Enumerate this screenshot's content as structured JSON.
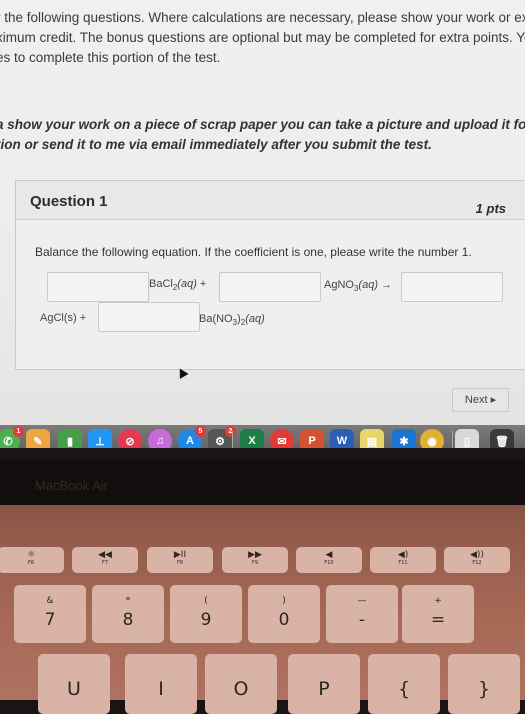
{
  "instructions": {
    "line1": "r the following questions.  Where calculations are necessary, please show your work or explain",
    "line2": "ximum credit.  The bonus questions are optional but may be completed for extra points.  You ha",
    "line3": "es to complete this portion of the test.",
    "line4": "a show your work on a piece of scrap paper you can take a picture and upload it for the last",
    "line5": "tion or send it to me via email immediately after you submit the test."
  },
  "question": {
    "title": "Question 1",
    "points": "1 pts",
    "prompt": "Balance the following equation.  If the coefficient is one, please write the number 1.",
    "terms": {
      "bacl2": "BaCl",
      "bacl2_sub": "2",
      "bacl2_state": "(aq)",
      "plus1": "+",
      "agno3": "AgNO",
      "agno3_sub": "3",
      "agno3_state": "(aq)",
      "arrow": "→",
      "agcl": "AgCl(s)",
      "plus2": "+",
      "bano3": "Ba(NO",
      "bano3_sub1": "3",
      "bano3_mid": ")",
      "bano3_sub2": "2",
      "bano3_state": "(aq)"
    },
    "blanks": [
      "",
      "",
      "",
      ""
    ]
  },
  "navigation": {
    "next_label": "Next ▸"
  },
  "dock": {
    "apps": [
      {
        "name": "FaceTime",
        "glyph": "✆",
        "color": "#4caf50",
        "badge": "1"
      },
      {
        "name": "Pages",
        "glyph": "✎",
        "color": "#f0a640"
      },
      {
        "name": "Numbers",
        "glyph": "▮",
        "color": "#43a047"
      },
      {
        "name": "Keynote",
        "glyph": "⊥",
        "color": "#2196f3"
      },
      {
        "name": "News",
        "glyph": "⊘",
        "color": "#e53950"
      },
      {
        "name": "iTunes",
        "glyph": "♫",
        "color": "#c66bd8"
      },
      {
        "name": "App Store",
        "glyph": "A",
        "color": "#1e88e5",
        "badge": "5"
      },
      {
        "name": "System Preferences",
        "glyph": "⚙",
        "color": "#555555",
        "badge": "2"
      },
      {
        "name": "Excel",
        "glyph": "X",
        "color": "#1e7e45"
      },
      {
        "name": "Mail",
        "glyph": "✉",
        "color": "#e53935"
      },
      {
        "name": "PowerPoint",
        "glyph": "P",
        "color": "#d35230"
      },
      {
        "name": "Word",
        "glyph": "W",
        "color": "#2b5fb5"
      },
      {
        "name": "Stickies",
        "glyph": "▤",
        "color": "#e8d66a"
      },
      {
        "name": "Bluetooth File Exchange",
        "glyph": "✱",
        "color": "#1976d2"
      },
      {
        "name": "Chrome",
        "glyph": "◉",
        "color": "#e0b030"
      },
      {
        "name": "Documents",
        "glyph": "▯",
        "color": "#d8d8d8"
      },
      {
        "name": "Trash",
        "glyph": "🗑",
        "color": "#3a3a3a"
      }
    ]
  },
  "laptop": {
    "brand": "MacBook Air"
  },
  "keyboard": {
    "fkeys": [
      {
        "sym": "☼",
        "label": "F6"
      },
      {
        "sym": "◀◀",
        "label": "F7"
      },
      {
        "sym": "▶II",
        "label": "F8"
      },
      {
        "sym": "▶▶",
        "label": "F9"
      },
      {
        "sym": "◀",
        "label": "F10"
      },
      {
        "sym": "◀)",
        "label": "F11"
      },
      {
        "sym": "◀))",
        "label": "F12"
      }
    ],
    "numkeys": [
      {
        "top": "&",
        "main": "7"
      },
      {
        "top": "*",
        "main": "8"
      },
      {
        "top": "(",
        "main": "9"
      },
      {
        "top": ")",
        "main": "0"
      },
      {
        "top": "—",
        "main": "-"
      },
      {
        "top": "+",
        "main": "="
      }
    ],
    "letterkeys": [
      "U",
      "I",
      "O",
      "P",
      "{",
      "}"
    ]
  }
}
